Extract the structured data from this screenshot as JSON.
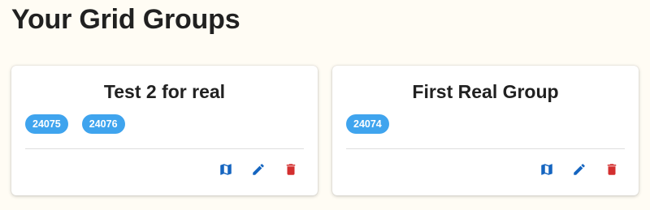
{
  "page": {
    "title": "Your Grid Groups"
  },
  "colors": {
    "background": "#fffcf4",
    "chip": "#3fa4ee",
    "map_icon": "#1565c0",
    "edit_icon": "#1565c0",
    "delete_icon": "#d32f2f"
  },
  "groups": [
    {
      "name": "Test 2 for real",
      "grids": [
        "24075",
        "24076"
      ],
      "actions": [
        "map-icon",
        "edit-icon",
        "delete-icon"
      ]
    },
    {
      "name": "First Real Group",
      "grids": [
        "24074"
      ],
      "actions": [
        "map-icon",
        "edit-icon",
        "delete-icon"
      ]
    }
  ]
}
